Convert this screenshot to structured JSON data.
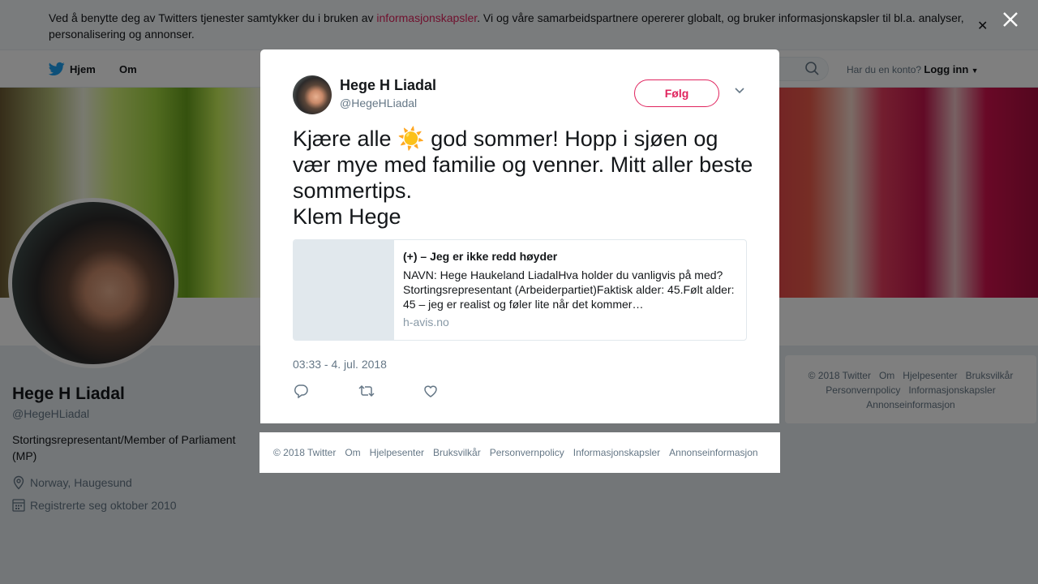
{
  "cookie": {
    "text_before": "Ved å benytte deg av Twitters tjenester samtykker du i bruken av ",
    "link": "informasjonskapsler",
    "text_after": ". Vi og våre samarbeidspartnere opererer globalt, og bruker informasjonskapsler til bl.a. analyser, personalisering og annonser.",
    "close_icon": "close-icon"
  },
  "nav": {
    "home": "Hjem",
    "about": "Om",
    "account_prompt": "Har du en konto?",
    "login": "Logg inn"
  },
  "profile": {
    "name": "Hege H Liadal",
    "handle": "@HegeHLiadal",
    "bio": "Stortingsrepresentant/Member of Parliament (MP)",
    "location": "Norway, Haugesund",
    "joined": "Registrerte seg oktober 2010"
  },
  "side_footer": {
    "links": [
      "© 2018 Twitter",
      "Om",
      "Hjelpesenter",
      "Bruksvilkår",
      "Personvernpolicy",
      "Informasjonskapsler",
      "Annonseinformasjon"
    ]
  },
  "tweet": {
    "name": "Hege H Liadal",
    "handle": "@HegeHLiadal",
    "follow": "Følg",
    "text_part1": "Kjære alle ",
    "emoji": "☀️",
    "text_part2": " god sommer! Hopp i sjøen og vær mye med familie og venner. Mitt aller beste sommertips.\nKlem Hege",
    "card": {
      "title": "(+) – Jeg er ikke redd høyder",
      "description": "NAVN: Hege Haukeland LiadalHva holder du vanligvis på med? Stortingsrepresentant (Arbeiderpartiet)Faktisk alder: 45.Følt alder: 45 – jeg er realist og føler lite når det kommer…",
      "domain": "h-avis.no"
    },
    "timestamp": "03:33 - 4. jul. 2018"
  },
  "modal_footer": {
    "links": [
      "© 2018 Twitter",
      "Om",
      "Hjelpesenter",
      "Bruksvilkår",
      "Personvernpolicy",
      "Informasjonskapsler",
      "Annonseinformasjon"
    ]
  },
  "colors": {
    "accent": "#e0245e",
    "twitter_blue": "#1da1f2",
    "muted": "#657786"
  }
}
